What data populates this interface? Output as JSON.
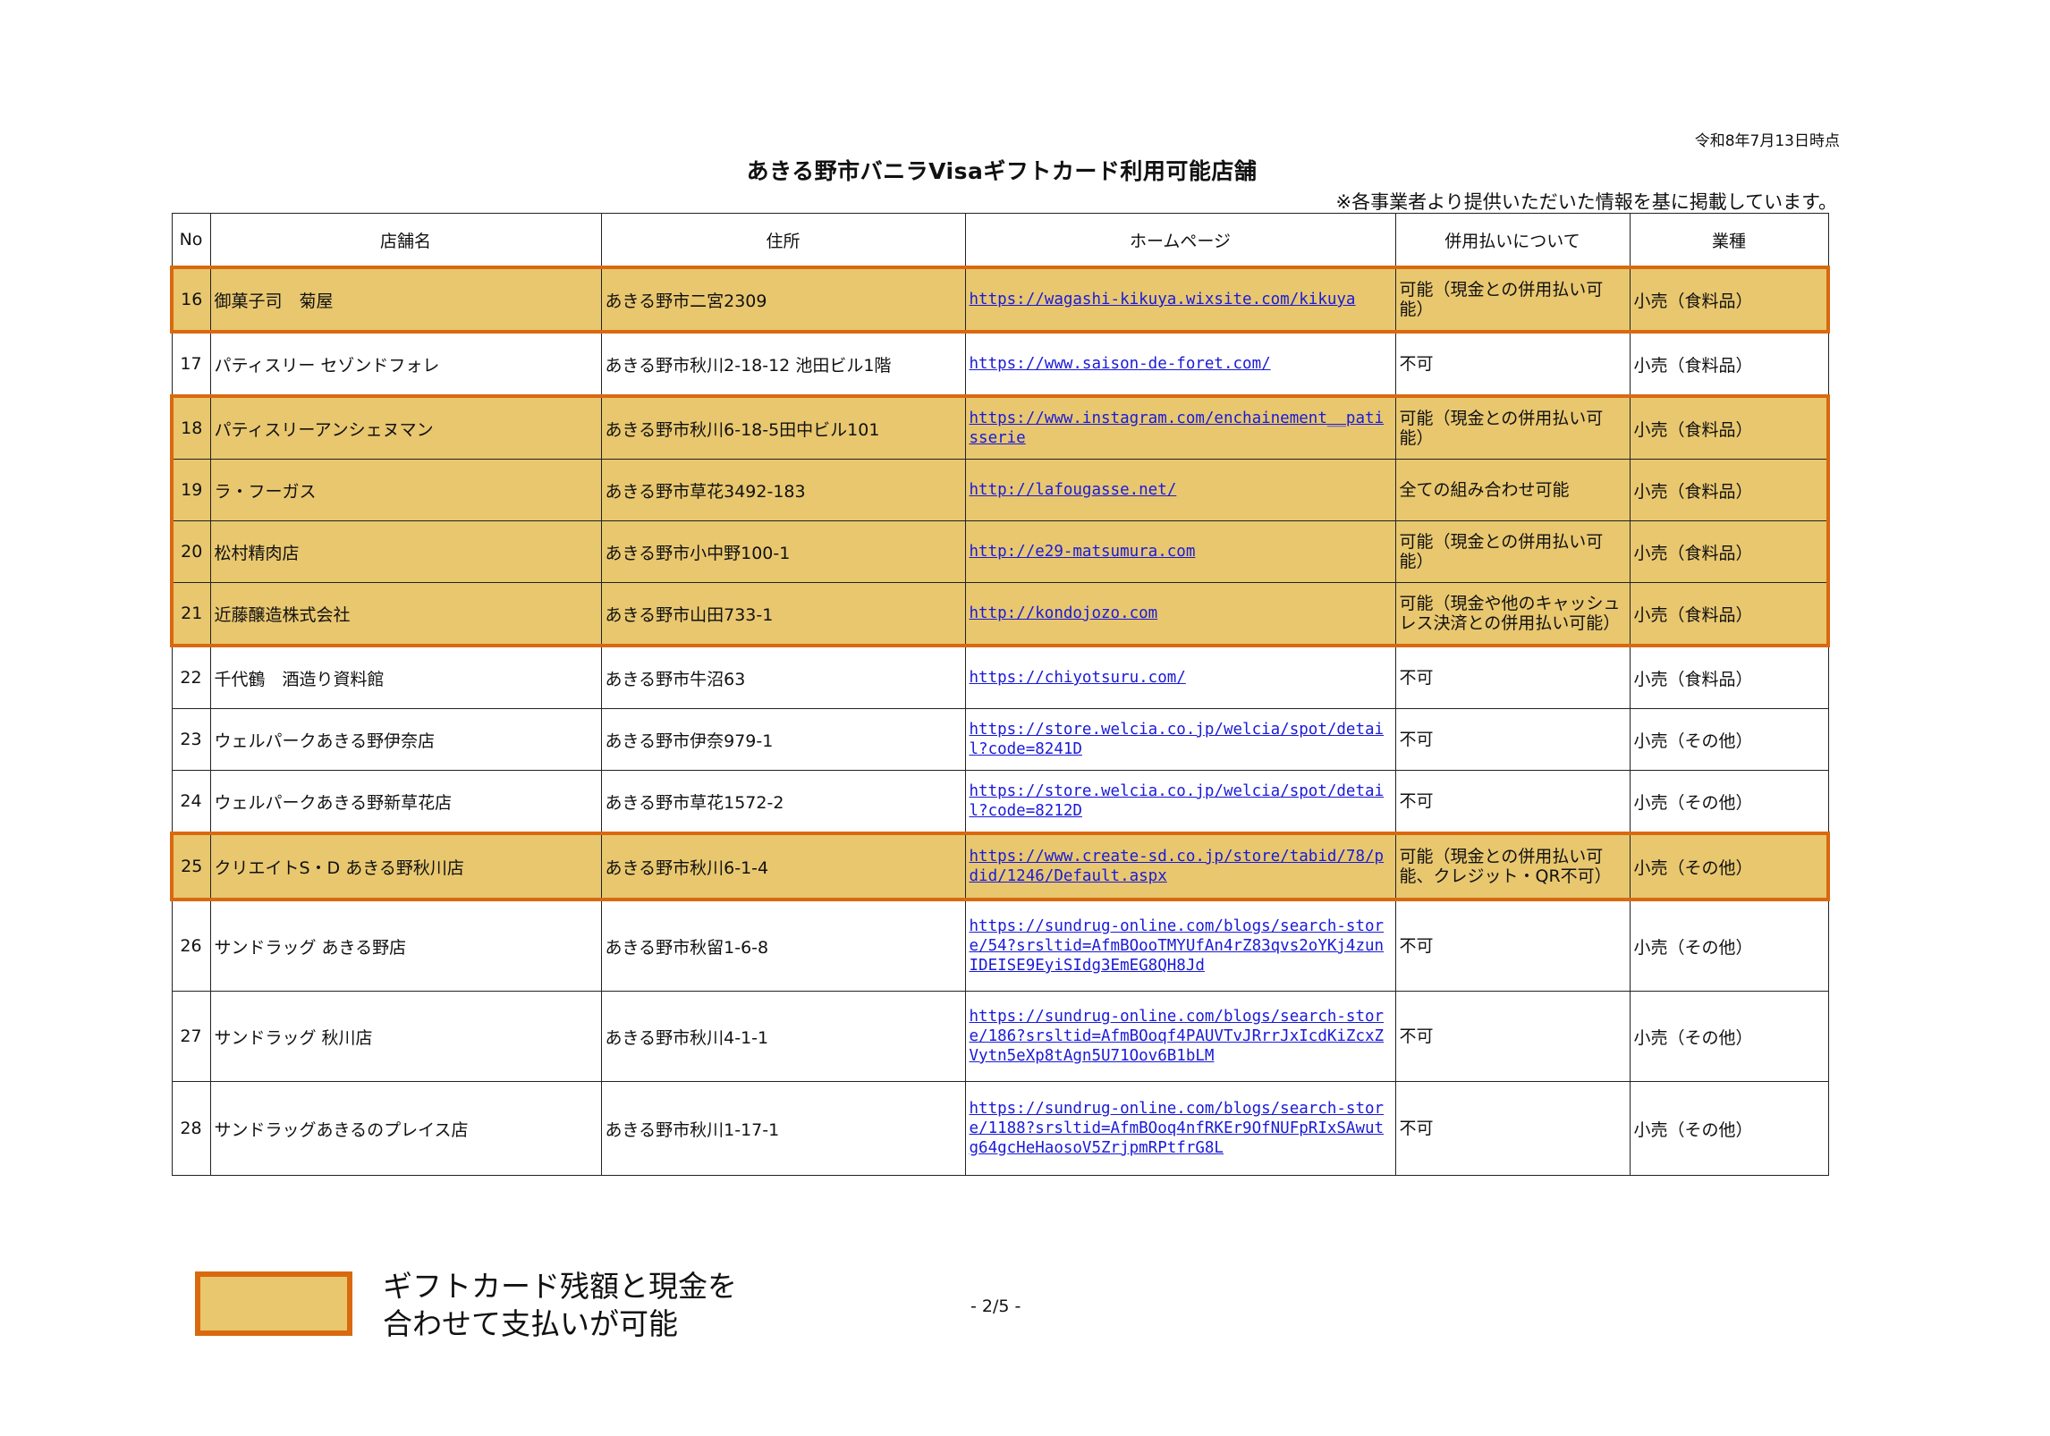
{
  "header": {
    "date": "令和8年7月13日時点",
    "title": "あきる野市バニラVisaギフトカード利用可能店舗",
    "note": "※各事業者より提供いただいた情報を基に掲載しています。"
  },
  "table": {
    "columns": [
      "No",
      "店舗名",
      "住所",
      "ホームページ",
      "併用払いについて",
      "業種"
    ],
    "rows": [
      {
        "no": "16",
        "name": "御菓子司　菊屋",
        "address": "あきる野市二宮2309",
        "url": "https://wagashi-kikuya.wixsite.com/kikuya",
        "payment": "可能（現金との併用払い可能）",
        "category": "小売（食料品）"
      },
      {
        "no": "17",
        "name": "パティスリー セゾンドフォレ",
        "address": "あきる野市秋川2-18-12 池田ビル1階",
        "url": "https://www.saison-de-foret.com/",
        "payment": "不可",
        "category": "小売（食料品）"
      },
      {
        "no": "18",
        "name": "パティスリーアンシェヌマン",
        "address": "あきる野市秋川6-18-5田中ビル101",
        "url": "https://www.instagram.com/enchainement__patisserie",
        "payment": "可能（現金との併用払い可能）",
        "category": "小売（食料品）"
      },
      {
        "no": "19",
        "name": "ラ・フーガス",
        "address": "あきる野市草花3492-183",
        "url": "http://lafougasse.net/",
        "payment": "全ての組み合わせ可能",
        "category": "小売（食料品）"
      },
      {
        "no": "20",
        "name": "松村精肉店",
        "address": "あきる野市小中野100-1",
        "url": "http://e29-matsumura.com",
        "payment": "可能（現金との併用払い可能）",
        "category": "小売（食料品）"
      },
      {
        "no": "21",
        "name": "近藤醸造株式会社",
        "address": "あきる野市山田733-1",
        "url": "http://kondojozo.com",
        "payment": "可能（現金や他のキャッシュレス決済との併用払い可能）",
        "category": "小売（食料品）"
      },
      {
        "no": "22",
        "name": "千代鶴　酒造り資料館",
        "address": "あきる野市牛沼63",
        "url": "https://chiyotsuru.com/",
        "payment": "不可",
        "category": "小売（食料品）"
      },
      {
        "no": "23",
        "name": "ウェルパークあきる野伊奈店",
        "address": "あきる野市伊奈979-1",
        "url": "https://store.welcia.co.jp/welcia/spot/detail?code=8241D",
        "payment": "不可",
        "category": "小売（その他）"
      },
      {
        "no": "24",
        "name": "ウェルパークあきる野新草花店",
        "address": "あきる野市草花1572-2",
        "url": "https://store.welcia.co.jp/welcia/spot/detail?code=8212D",
        "payment": "不可",
        "category": "小売（その他）"
      },
      {
        "no": "25",
        "name": "クリエイトS・D あきる野秋川店",
        "address": "あきる野市秋川6-1-4",
        "url": "https://www.create-sd.co.jp/store/tabid/78/pdid/1246/Default.aspx",
        "payment": "可能（現金との併用払い可能、クレジット・QR不可）",
        "category": "小売（その他）"
      },
      {
        "no": "26",
        "name": "サンドラッグ あきる野店",
        "address": "あきる野市秋留1-6-8",
        "url": "https://sundrug-online.com/blogs/search-store/54?srsltid=AfmBOooTMYUfAn4rZ83qvs2oYKj4zunIDEISE9EyiSIdg3EmEG8QH8Jd",
        "payment": "不可",
        "category": "小売（その他）"
      },
      {
        "no": "27",
        "name": "サンドラッグ 秋川店",
        "address": "あきる野市秋川4-1-1",
        "url": "https://sundrug-online.com/blogs/search-store/186?srsltid=AfmBOoqf4PAUVTvJRrrJxIcdKiZcxZVytn5eXp8tAgn5U71Oov6B1bLM",
        "payment": "不可",
        "category": "小売（その他）"
      },
      {
        "no": "28",
        "name": "サンドラッグあきるのプレイス店",
        "address": "あきる野市秋川1-17-1",
        "url": "https://sundrug-online.com/blogs/search-store/1188?srsltid=AfmBOoq4nfRKEr9OfNUFpRIxSAwutg64gcHeHaosoV5ZrjpmRPtfrG8L",
        "payment": "不可",
        "category": "小売（その他）"
      }
    ]
  },
  "legend": {
    "line1": "ギフトカード残額と現金を",
    "line2": "合わせて支払いが可能",
    "highlight_color": "#e8c76f",
    "border_color": "#d9690f"
  },
  "footer": {
    "page": "- 2/5 -"
  }
}
